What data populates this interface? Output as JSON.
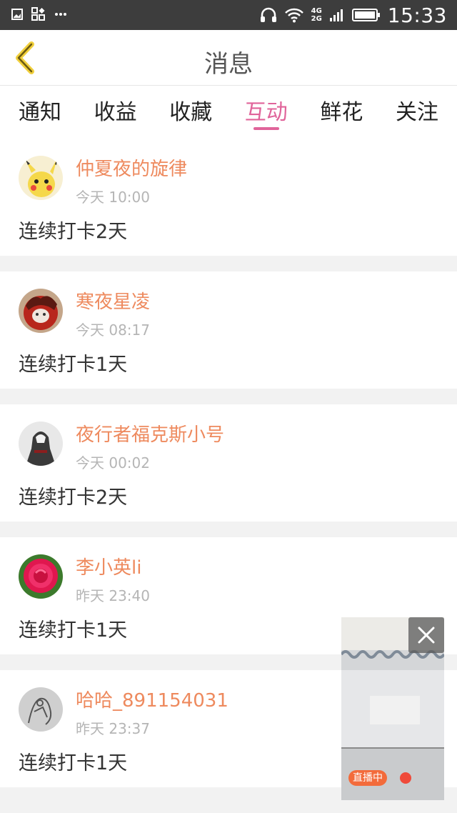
{
  "status_bar": {
    "time": "15:33",
    "network": [
      "4G",
      "2G"
    ],
    "icons": [
      "image-icon",
      "apps-icon",
      "more-icon",
      "headset-icon",
      "wifi-icon",
      "signal-icon",
      "battery-icon"
    ]
  },
  "header": {
    "title": "消息",
    "back_icon": "chevron-left-icon"
  },
  "tabs": [
    {
      "label": "通知",
      "active": false
    },
    {
      "label": "收益",
      "active": false
    },
    {
      "label": "收藏",
      "active": false
    },
    {
      "label": "互动",
      "active": true
    },
    {
      "label": "鲜花",
      "active": false
    },
    {
      "label": "关注",
      "active": false
    }
  ],
  "messages": [
    {
      "name": "仲夏夜的旋律",
      "time": "今天 10:00",
      "content": "连续打卡2天"
    },
    {
      "name": "寒夜星凌",
      "time": "今天 08:17",
      "content": "连续打卡1天"
    },
    {
      "name": "夜行者福克斯小号",
      "time": "今天 00:02",
      "content": "连续打卡2天"
    },
    {
      "name": "李小英li",
      "time": "昨天 23:40",
      "content": "连续打卡1天"
    },
    {
      "name": "哈哈_891154031",
      "time": "昨天 23:37",
      "content": "连续打卡1天"
    }
  ],
  "live_window": {
    "badge": "直播中",
    "close_icon": "close-icon"
  },
  "colors": {
    "accent_pink": "#e0649a",
    "name_orange": "#ee8a5e",
    "back_yellow": "#f0cf3c",
    "live_orange": "#f36b3b"
  }
}
